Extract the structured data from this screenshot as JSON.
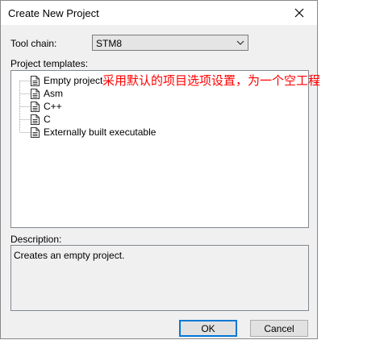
{
  "dialog": {
    "title": "Create New Project",
    "toolchain_label": "Tool chain:",
    "toolchain_value": "STM8",
    "templates_label": "Project templates:",
    "templates": [
      {
        "label": "Empty project"
      },
      {
        "label": "Asm"
      },
      {
        "label": "C++"
      },
      {
        "label": "C"
      },
      {
        "label": "Externally built executable"
      }
    ],
    "description_label": "Description:",
    "description": "Creates an empty project.",
    "ok_label": "OK",
    "cancel_label": "Cancel"
  },
  "annotation": {
    "text": "采用默认的项目选项设置，为一个空工程",
    "color": "#ff0000"
  },
  "icons": {
    "close": "close-icon",
    "dropdown": "chevron-down-icon",
    "template": "document-icon"
  }
}
